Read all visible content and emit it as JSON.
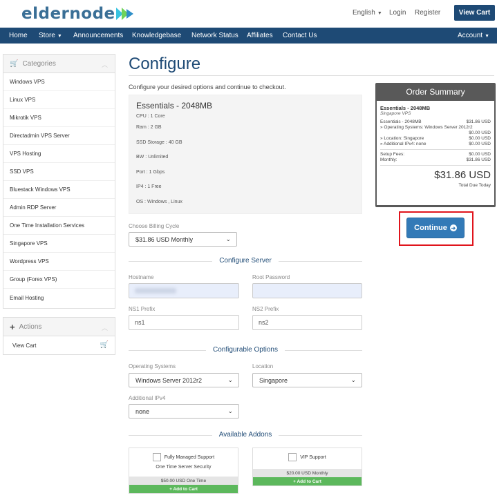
{
  "header": {
    "logo": "eldernode",
    "language": "English",
    "login": "Login",
    "register": "Register",
    "view_cart": "View Cart"
  },
  "nav": {
    "items": [
      "Home",
      "Store",
      "Announcements",
      "Knowledgebase",
      "Network Status",
      "Affiliates",
      "Contact Us"
    ],
    "account": "Account"
  },
  "sidebar": {
    "categories_title": "Categories",
    "categories": [
      "Windows VPS",
      "Linux VPS",
      "Mikrotik VPS",
      "Directadmin VPS Server",
      "VPS Hosting",
      "SSD VPS",
      "Bluestack Windows VPS",
      "Admin RDP Server",
      "One Time Installation Services",
      "Singapore VPS",
      "Wordpress VPS",
      "Group (Forex VPS)",
      "Email Hosting"
    ],
    "actions_title": "Actions",
    "actions": [
      "View Cart"
    ]
  },
  "main": {
    "title": "Configure",
    "intro": "Configure your desired options and continue to checkout.",
    "product": {
      "name": "Essentials - 2048MB",
      "specs": [
        "CPU : 1 Core",
        "Ram : 2 GB",
        "SSD Storage : 40 GB",
        "BW : Unlimited",
        "Port : 1 Gbps",
        "IP4 : 1 Free",
        "OS : Windows , Linux"
      ]
    },
    "billing": {
      "label": "Choose Billing Cycle",
      "value": "$31.86 USD Monthly"
    },
    "configure_server": {
      "title": "Configure Server",
      "hostname_label": "Hostname",
      "root_password_label": "Root Password",
      "ns1_label": "NS1 Prefix",
      "ns1_value": "ns1",
      "ns2_label": "NS2 Prefix",
      "ns2_value": "ns2"
    },
    "configurable_options": {
      "title": "Configurable Options",
      "os_label": "Operating Systems",
      "os_value": "Windows Server 2012r2",
      "location_label": "Location",
      "location_value": "Singapore",
      "ipv4_label": "Additional IPv4",
      "ipv4_value": "none"
    },
    "addons": {
      "title": "Available Addons",
      "items": [
        {
          "name": "Fully Managed Support",
          "desc": "One Time Server Security",
          "price": "$50.00 USD One Time",
          "button": "+ Add to Cart"
        },
        {
          "name": "VIP Support",
          "desc": "",
          "price": "$20.00 USD Monthly",
          "button": "+ Add to Cart"
        }
      ]
    }
  },
  "summary": {
    "title": "Order Summary",
    "product": "Essentials - 2048MB",
    "group": "Singapore VPS",
    "lines": [
      {
        "label": "Essentials - 2048MB",
        "value": "$31.86 USD"
      },
      {
        "label": "» Operating Systems: Windows Server 2012r2",
        "value": ""
      },
      {
        "label": "",
        "value": "$0.00 USD"
      },
      {
        "label": "» Location: Singapore",
        "value": "$0.00 USD"
      },
      {
        "label": "» Additional IPv4: none",
        "value": "$0.00 USD"
      }
    ],
    "setup_fees_label": "Setup Fees:",
    "setup_fees": "$0.00 USD",
    "monthly_label": "Monthly:",
    "monthly": "$31.86 USD",
    "total": "$31.86 USD",
    "total_label": "Total Due Today",
    "continue": "Continue"
  },
  "colors": {
    "brand": "#1e4a75",
    "accent_green": "#5cb85c",
    "button_blue": "#337ab7",
    "highlight_red": "#e0141c"
  }
}
